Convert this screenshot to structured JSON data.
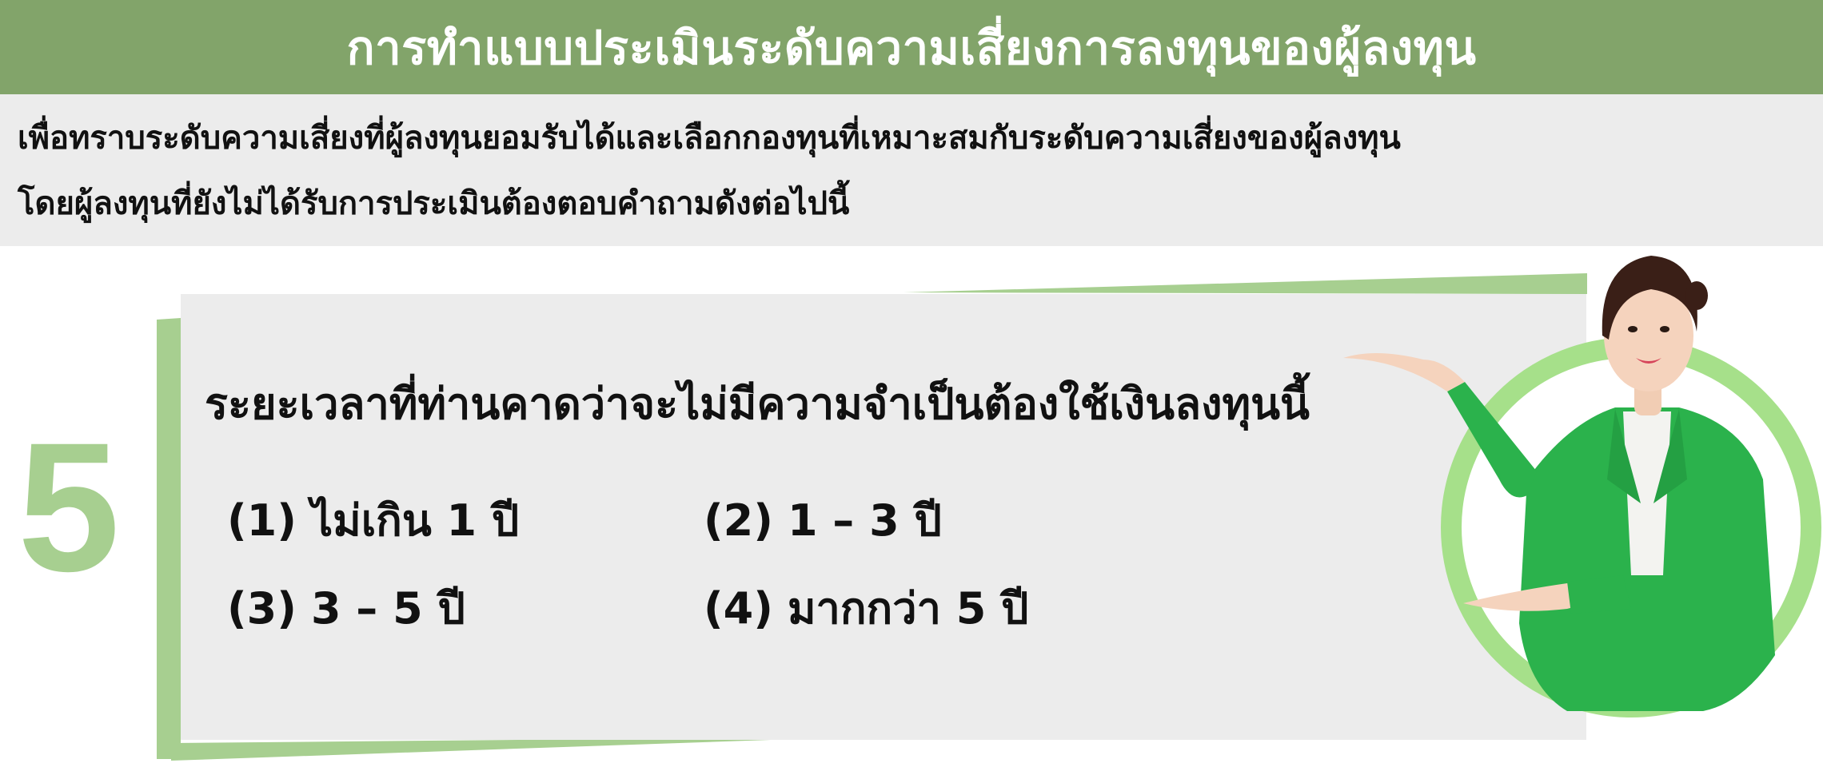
{
  "header": {
    "title": "การทำแบบประเมินระดับความเสี่ยงการลงทุนของผู้ลงทุน"
  },
  "intro": {
    "line1": "เพื่อทราบระดับความเสี่ยงที่ผู้ลงทุนยอมรับได้และเลือกกองทุนที่เหมาะสมกับระดับความเสี่ยงของผู้ลงทุน",
    "line2": "โดยผู้ลงทุนที่ยังไม่ได้รับการประเมินต้องตอบคำถามดังต่อไปนี้"
  },
  "question": {
    "number": "5",
    "text": "ระยะเวลาที่ท่านคาดว่าจะไม่มีความจำเป็นต้องใช้เงินลงทุนนี้",
    "options": [
      {
        "num": "(1)",
        "label": "ไม่เกิน 1 ปี"
      },
      {
        "num": "(2)",
        "label": "1 – 3 ปี"
      },
      {
        "num": "(3)",
        "label": "3 – 5 ปี"
      },
      {
        "num": "(4)",
        "label": "มากกว่า 5 ปี"
      }
    ]
  },
  "colors": {
    "header_green": "#82a46a",
    "accent_green": "#a7cf90",
    "ring_green": "#a6e08a",
    "panel_gray": "#ececec",
    "jacket_green": "#2bb24c"
  },
  "icons": {
    "presenter": "presenter-woman-illustration"
  }
}
